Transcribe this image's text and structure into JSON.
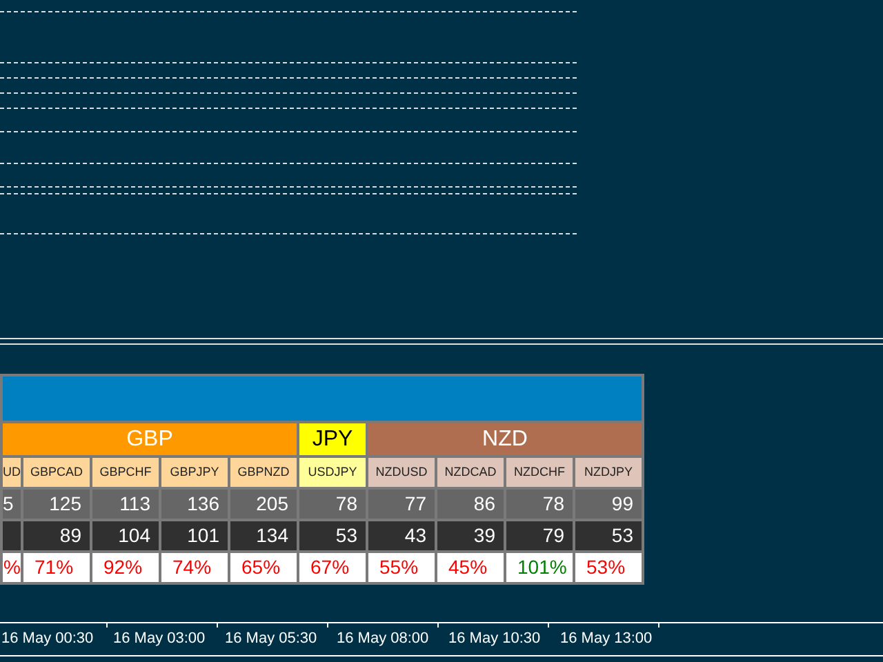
{
  "table": {
    "groups": [
      {
        "name": "GBP",
        "color": "#ff9900",
        "pairs": [
          {
            "name": "UD",
            "row_1": "5",
            "pct": "%",
            "color": "#ff0000"
          },
          {
            "name": "GBPCAD",
            "row_1": "125",
            "row_2": "89",
            "pct": "71%",
            "color": "#ff0000"
          },
          {
            "name": "GBPCHF",
            "row_1": "113",
            "row_2": "104",
            "pct": "92%",
            "color": "#ff0000"
          },
          {
            "name": "GBPJPY",
            "row_1": "136",
            "row_2": "101",
            "pct": "74%",
            "color": "#ff0000"
          },
          {
            "name": "GBPNZD",
            "row_1": "205",
            "row_2": "134",
            "pct": "65%",
            "color": "#ff0000"
          }
        ]
      },
      {
        "name": "JPY",
        "color": "#ffff00",
        "pairs": [
          {
            "name": "USDJPY",
            "row_1": "78",
            "row_2": "53",
            "pct": "67%",
            "color": "#ff0000"
          }
        ]
      },
      {
        "name": "NZD",
        "color": "#b06e50",
        "pairs": [
          {
            "name": "NZDUSD",
            "row_1": "77",
            "row_2": "43",
            "pct": "55%",
            "color": "#ff0000"
          },
          {
            "name": "NZDCAD",
            "row_1": "86",
            "row_2": "39",
            "pct": "45%",
            "color": "#ff0000"
          },
          {
            "name": "NZDCHF",
            "row_1": "78",
            "row_2": "79",
            "pct": "101%",
            "color": "#008000"
          },
          {
            "name": "NZDJPY",
            "row_1": "99",
            "row_2": "53",
            "pct": "53%",
            "color": "#ff0000"
          }
        ]
      }
    ]
  },
  "time_axis": [
    "16 May 00:30",
    "16 May 03:00",
    "16 May 05:30",
    "16 May 08:00",
    "16 May 10:30",
    "16 May 13:00"
  ]
}
